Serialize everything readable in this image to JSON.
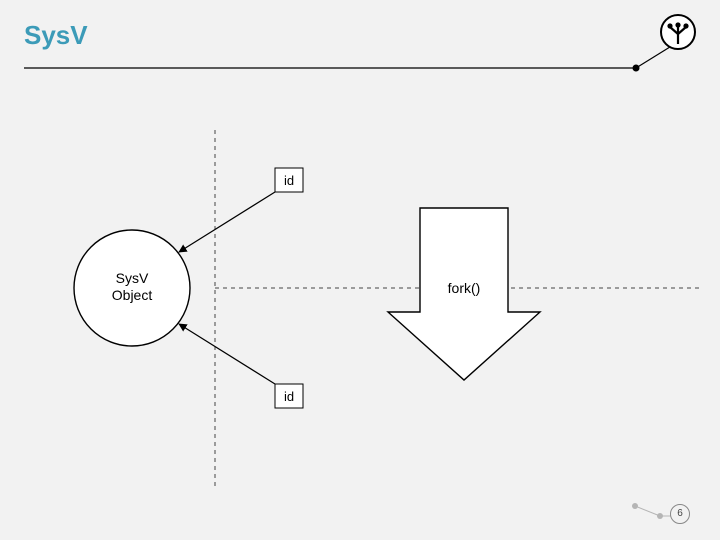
{
  "title": "SysV",
  "diagram": {
    "object_label_line1": "SysV",
    "object_label_line2": "Object",
    "id_top": "id",
    "id_bottom": "id",
    "fork_label": "fork()"
  },
  "page_number": "6"
}
